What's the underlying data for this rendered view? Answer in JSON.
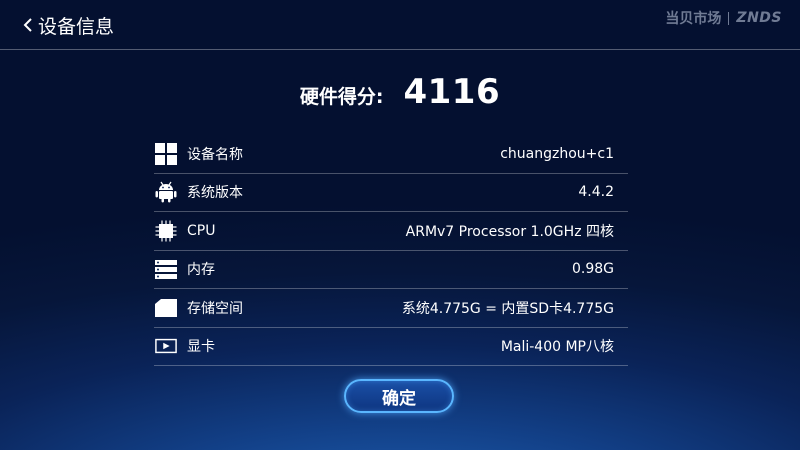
{
  "header": {
    "back_label": "设备信息",
    "brand_cn": "当贝市场",
    "brand_en": "ZNDS"
  },
  "score": {
    "label": "硬件得分:",
    "value": "4116"
  },
  "rows": [
    {
      "icon": "grid-icon",
      "label": "设备名称",
      "value": "chuangzhou+c1"
    },
    {
      "icon": "android-icon",
      "label": "系统版本",
      "value": "4.4.2"
    },
    {
      "icon": "cpu-chip-icon",
      "label": "CPU",
      "value": "ARMv7 Processor 1.0GHz 四核"
    },
    {
      "icon": "memory-icon",
      "label": "内存",
      "value": "0.98G"
    },
    {
      "icon": "folder-icon",
      "label": "存储空间",
      "value": "系统4.775G = 内置SD卡4.775G"
    },
    {
      "icon": "gpu-play-icon",
      "label": "显卡",
      "value": "Mali-400 MP八核"
    }
  ],
  "confirm_label": "确定",
  "colors": {
    "background_top": "#04102f",
    "background_glow": "#1f63b8",
    "button_border": "#5ab6ff"
  }
}
